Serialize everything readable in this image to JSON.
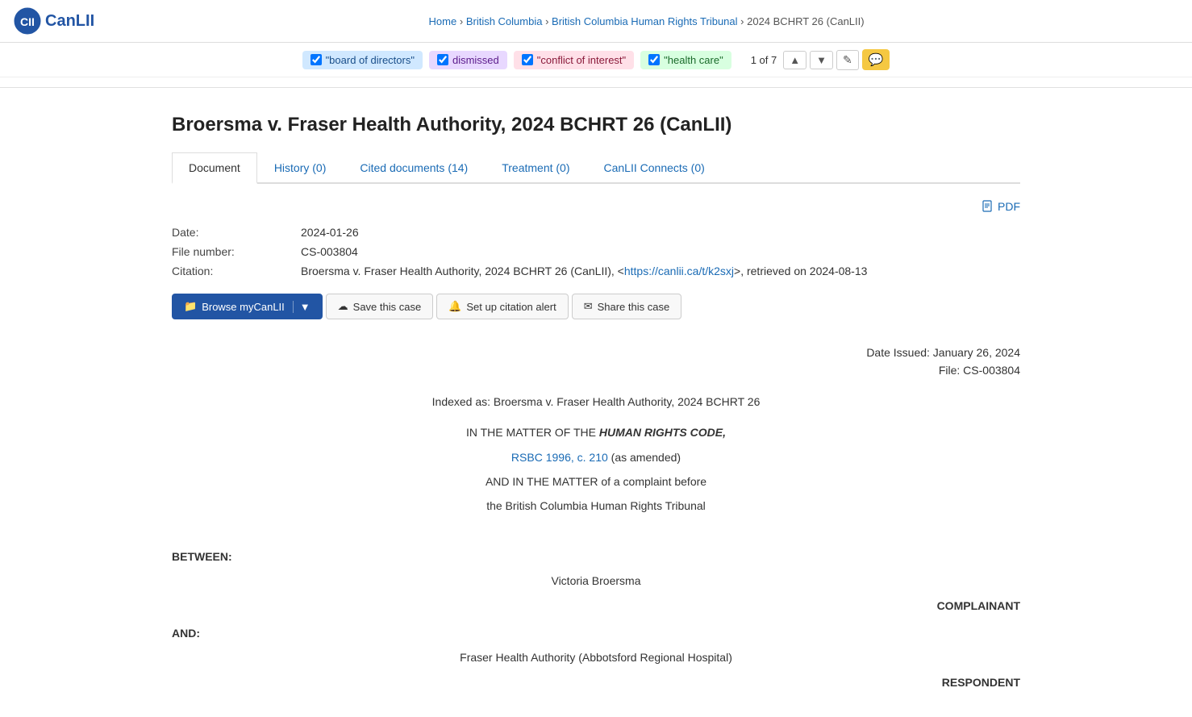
{
  "header": {
    "logo_text": "CanLII",
    "logo_can": "Can",
    "logo_lii": "LII"
  },
  "breadcrumb": {
    "home": "Home",
    "separator1": "›",
    "bc": "British Columbia",
    "separator2": "›",
    "tribunal": "British Columbia Human Rights Tribunal",
    "separator3": "›",
    "current": "2024 BCHRT 26 (CanLII)"
  },
  "search_tags": [
    {
      "id": "tag1",
      "label": "\"board of directors\"",
      "color": "blue",
      "checked": true
    },
    {
      "id": "tag2",
      "label": "dismissed",
      "color": "purple",
      "checked": true
    },
    {
      "id": "tag3",
      "label": "\"conflict of interest\"",
      "color": "pink",
      "checked": true
    },
    {
      "id": "tag4",
      "label": "\"health care\"",
      "color": "green",
      "checked": true
    }
  ],
  "pagination": {
    "current": "1",
    "total": "7",
    "display": "1 of 7"
  },
  "case_title": "Broersma v. Fraser Health Authority, 2024 BCHRT 26 (CanLII)",
  "tabs": [
    {
      "id": "document",
      "label": "Document",
      "active": true
    },
    {
      "id": "history",
      "label": "History (0)",
      "active": false
    },
    {
      "id": "cited",
      "label": "Cited documents (14)",
      "active": false
    },
    {
      "id": "treatment",
      "label": "Treatment (0)",
      "active": false
    },
    {
      "id": "canlii_connects",
      "label": "CanLII Connects (0)",
      "active": false
    }
  ],
  "metadata": {
    "date_label": "Date:",
    "date_value": "2024-01-26",
    "file_label": "File number:",
    "file_value": "CS-003804",
    "citation_label": "Citation:",
    "citation_prefix": "Broersma v. Fraser Health Authority, 2024 BCHRT 26 (CanLII), <",
    "citation_link_text": "https://canlii.ca/t/k2sxj",
    "citation_link_href": "https://canlii.ca/t/k2sxj",
    "citation_suffix": ">, retrieved on 2024-08-13"
  },
  "pdf_label": "PDF",
  "action_buttons": {
    "browse": "Browse myCanLII",
    "save": "Save this case",
    "alert": "Set up citation alert",
    "share": "Share this case"
  },
  "document_body": {
    "date_issued": "Date Issued: January 26, 2024",
    "file": "File: CS-003804",
    "indexed_as": "Indexed as: Broersma v. Fraser Health Authority, 2024 BCHRT 26",
    "matter_line1_prefix": "IN THE MATTER OF THE ",
    "matter_law": "HUMAN RIGHTS CODE,",
    "matter_line2_prefix": "",
    "matter_link_text": "RSBC 1996, c. 210",
    "matter_link_href": "#",
    "matter_line2_suffix": " (as amended)",
    "matter_and": "AND IN THE MATTER of a complaint before",
    "matter_tribunal": "the British Columbia Human Rights Tribunal",
    "between": "BETWEEN:",
    "complainant_name": "Victoria Broersma",
    "complainant_label": "COMPLAINANT",
    "and_label": "AND:",
    "respondent_name": "Fraser Health Authority (Abbotsford Regional Hospital)",
    "respondent_label": "RESPONDENT"
  }
}
